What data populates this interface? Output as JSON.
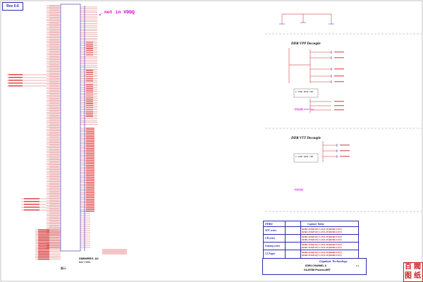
{
  "revision": "Rev 0.6",
  "note": "not in VDDQ",
  "sections": {
    "ddr_vpp_decap": {
      "title": "DDR VPP Decouple",
      "magenta_note": "* 整板總數 20010 Cap"
    },
    "ddr_vtt_decap": {
      "title": "DDR VTT Decouple",
      "magenta_note": "* 整板總數"
    },
    "cap_value_labels": [
      "1 1206 0603 CAP",
      "1 1206 0402 CAP"
    ]
  },
  "legend": {
    "header_left": "DDR4",
    "header_right": "Capture Value",
    "rows": [
      {
        "label": "SOC series",
        "values": [
          "DDR4 2133(0.6V) 1.2V(1.2V)(DDR) 2.5(V)",
          "DDR4 2133(0.6V) 1.2V(1.2V)(DDR) 2.5(V)"
        ]
      },
      {
        "label": "UR series",
        "values": [
          "DDR4 2133(0.6V) 1.2V(1.2V)(DDR) 2.5(V)",
          "DDR4 2133(0.6V) 1.2V(1.2V)(DDR) 2.5(V)"
        ]
      },
      {
        "label": "Gaming series",
        "values": [
          "DDR4 2133(0.6V) 1.2V(1.2V)(DDR) 2.5(V)",
          "DDR4 2133(0.6V) 1.2V(1.2V)(DDR) 2.5(V)"
        ]
      },
      {
        "label": "CL/Super",
        "values": [
          "DDR4 2133(0.6V) 1.2V(1.2V)(DDR) 2.5(V)",
          "DDR4 2133(0.6V) 1.2V(1.2V)(DDR) 2.5(V)"
        ]
      }
    ]
  },
  "title_block": {
    "company": "Gigabyte Technology",
    "title": "DDR4 CHANNEL A",
    "model": "GA-B75M Phoenix-MRT",
    "rev": "1.0"
  },
  "connector": {
    "label": "DIMM/REG_A2",
    "sub": "BA2 CHB0",
    "bottom_cn": "顯示"
  },
  "seal_chars": [
    "閥",
    "纸",
    "百",
    "图"
  ],
  "colors": {
    "wire": "#c81e1e",
    "body": "#2a2ab0",
    "magenta": "#d000d0",
    "text": "#000000"
  }
}
